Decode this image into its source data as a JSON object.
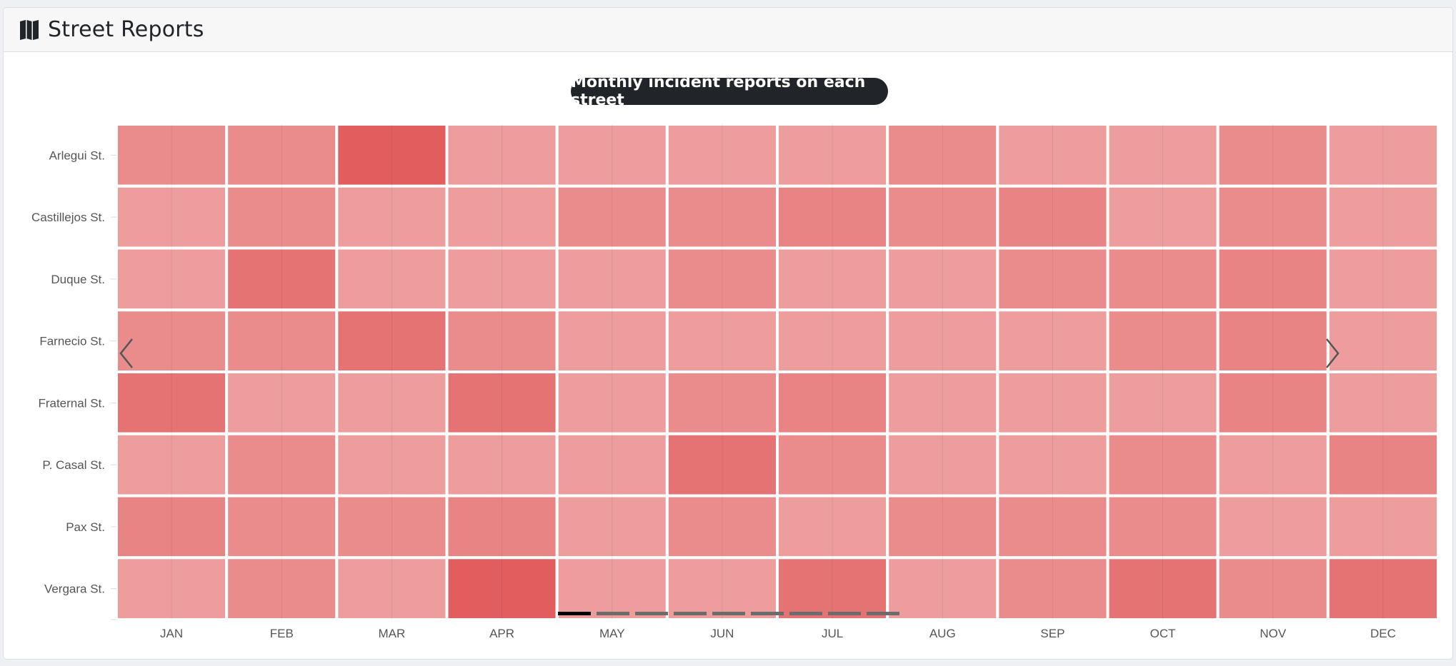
{
  "header": {
    "title": "Street Reports",
    "icon": "map-icon"
  },
  "chart_title": "Monthly incident reports on each street",
  "carousel": {
    "prev_icon": "chevron-left-icon",
    "next_icon": "chevron-right-icon",
    "indicator_count": 9,
    "active_indicator": 0
  },
  "colors": {
    "cell_base": "#e05050",
    "grid_line": "#ffffff",
    "axis_text": "#555555",
    "title_bg": "#212529"
  },
  "chart_data": {
    "type": "heatmap",
    "title": "Monthly incident reports on each street",
    "x_categories": [
      "JAN",
      "FEB",
      "MAR",
      "APR",
      "MAY",
      "JUN",
      "JUL",
      "AUG",
      "SEP",
      "OCT",
      "NOV",
      "DEC"
    ],
    "y_categories": [
      "Arlegui St.",
      "Castillejos St.",
      "Duque St.",
      "Farnecio St.",
      "Fraternal St.",
      "P. Casal St.",
      "Pax St.",
      "Vergara St."
    ],
    "values_relative_intensity": [
      [
        0.66,
        0.66,
        0.92,
        0.56,
        0.56,
        0.56,
        0.56,
        0.66,
        0.56,
        0.56,
        0.66,
        0.56
      ],
      [
        0.56,
        0.66,
        0.56,
        0.56,
        0.66,
        0.66,
        0.7,
        0.66,
        0.7,
        0.56,
        0.66,
        0.56
      ],
      [
        0.56,
        0.8,
        0.56,
        0.56,
        0.56,
        0.66,
        0.56,
        0.56,
        0.66,
        0.66,
        0.7,
        0.56
      ],
      [
        0.66,
        0.66,
        0.8,
        0.66,
        0.56,
        0.56,
        0.56,
        0.56,
        0.56,
        0.66,
        0.7,
        0.56
      ],
      [
        0.8,
        0.56,
        0.56,
        0.8,
        0.56,
        0.66,
        0.7,
        0.56,
        0.56,
        0.56,
        0.7,
        0.56
      ],
      [
        0.56,
        0.66,
        0.56,
        0.56,
        0.56,
        0.8,
        0.66,
        0.56,
        0.56,
        0.66,
        0.56,
        0.7
      ],
      [
        0.7,
        0.66,
        0.66,
        0.7,
        0.56,
        0.66,
        0.56,
        0.66,
        0.66,
        0.66,
        0.56,
        0.56
      ],
      [
        0.56,
        0.66,
        0.56,
        0.92,
        0.56,
        0.56,
        0.8,
        0.56,
        0.66,
        0.8,
        0.66,
        0.8
      ]
    ],
    "legend": "none",
    "grid": true
  }
}
